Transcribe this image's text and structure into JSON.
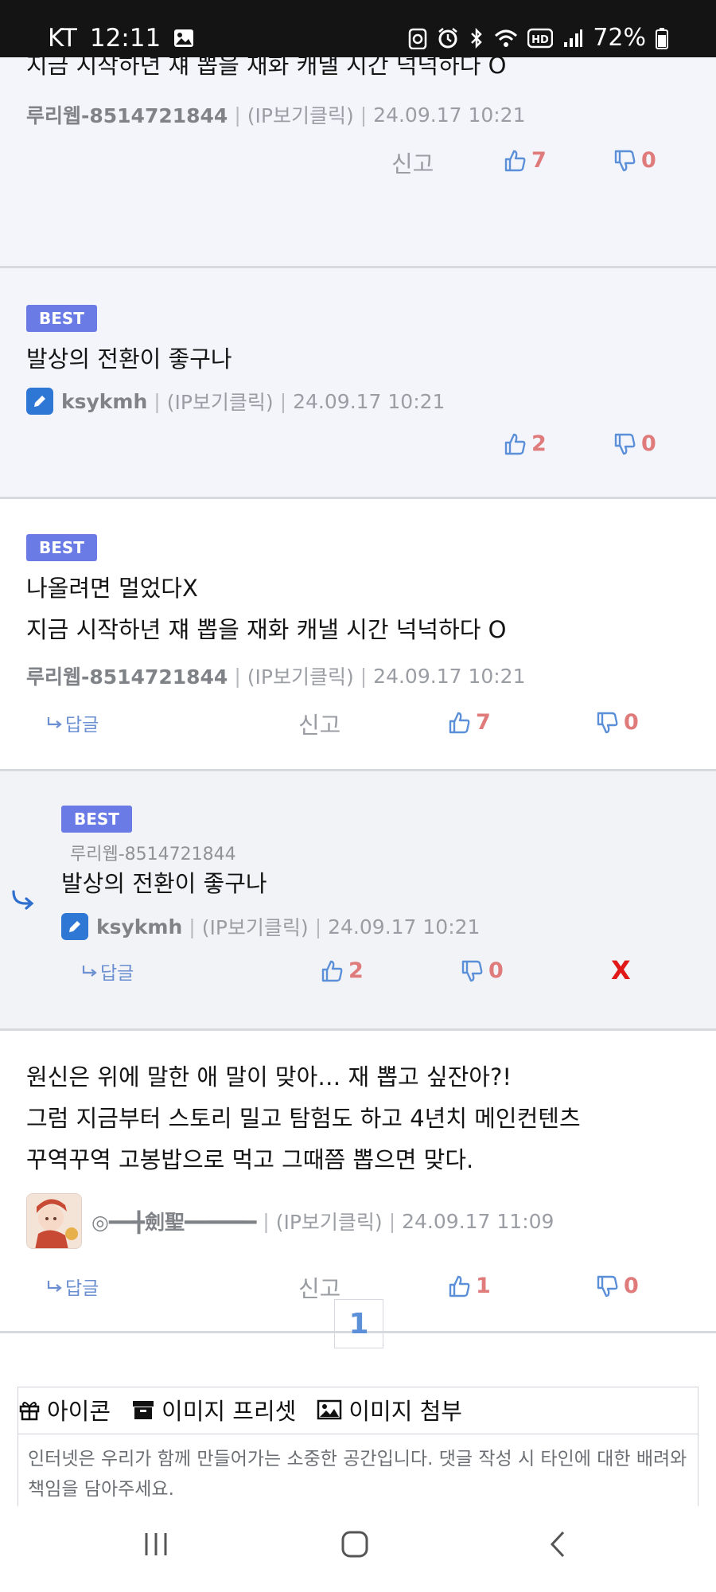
{
  "status_bar": {
    "carrier": "KT",
    "time": "12:11",
    "battery": "72%",
    "icons": [
      "gallery-icon",
      "recycle-icon",
      "alarm-icon",
      "bluetooth-icon",
      "wifi-icon",
      "hd-icon",
      "signal-icon",
      "battery-icon"
    ]
  },
  "comments": [
    {
      "text": [
        "지금 시작하년 쟤 뽑을 재화 캐낼 시간 넉넉하다 O"
      ],
      "author": "루리웹-8514721844",
      "ip": "(IP보기클릭)",
      "date": "24.09.17 10:21",
      "report": "신고",
      "up": "7",
      "down": "0"
    },
    {
      "badge": "BEST",
      "text": [
        "발상의 전환이 좋구나"
      ],
      "author": "ksykmh",
      "ip": "(IP보기클릭)",
      "date": "24.09.17 10:21",
      "up": "2",
      "down": "0"
    },
    {
      "badge": "BEST",
      "text": [
        "나올려면 멀었다X",
        "지금 시작하년 쟤 뽑을 재화 캐낼 시간 넉넉하다 O"
      ],
      "author": "루리웹-8514721844",
      "ip": "(IP보기클릭)",
      "date": "24.09.17 10:21",
      "reply": "답글",
      "report": "신고",
      "up": "7",
      "down": "0"
    },
    {
      "badge": "BEST",
      "parent": "루리웹-8514721844",
      "text": [
        "발상의 전환이 좋구나"
      ],
      "author": "ksykmh",
      "ip": "(IP보기클릭)",
      "date": "24.09.17 10:21",
      "reply": "답글",
      "up": "2",
      "down": "0",
      "delete": "X"
    },
    {
      "text": [
        "원신은 위에 말한 애 말이 맞아… 재 뽑고 싶잔아?!",
        "그럼 지금부터 스토리 밀고 탐험도 하고 4년치 메인컨텐츠",
        "꾸역꾸역 고봉밥으로 먹고 그때쯤 뽑으면 맞다."
      ],
      "author": "◎━━╋劍聖━━━━━━",
      "ip": "(IP보기클릭)",
      "date": "24.09.17 11:09",
      "reply": "답글",
      "report": "신고",
      "up": "1",
      "down": "0"
    }
  ],
  "pagination": {
    "current": "1"
  },
  "editor": {
    "icon_label": "아이콘",
    "preset_label": "이미지 프리셋",
    "attach_label": "이미지 첨부",
    "placeholder": "인터넷은 우리가 함께 만들어가는 소중한 공간입니다. 댓글 작성 시 타인에 대한 배려와 책임을 담아주세요."
  },
  "colors": {
    "accent": "#6b7be6",
    "vote": "#e07b7b",
    "link": "#6b8fd0",
    "delete": "#e01818"
  }
}
